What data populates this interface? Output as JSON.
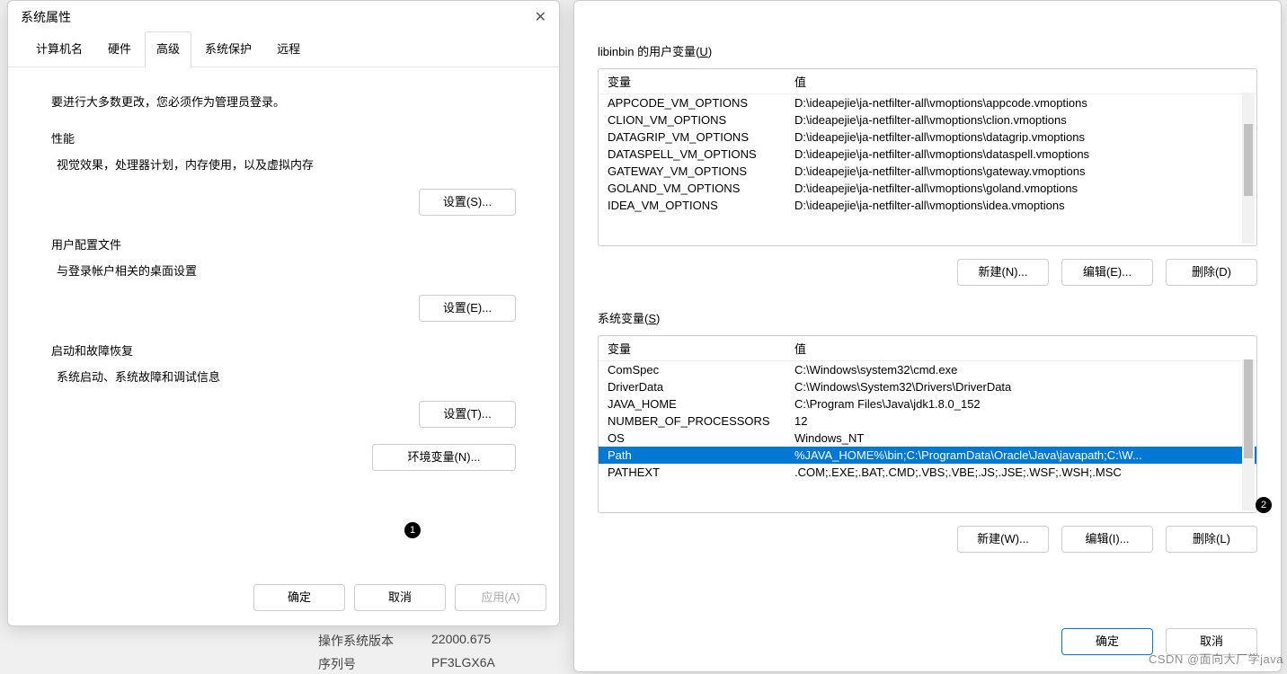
{
  "sysprops": {
    "title": "系统属性",
    "tabs": [
      "计算机名",
      "硬件",
      "高级",
      "系统保护",
      "远程"
    ],
    "active_tab": "高级",
    "admin_note": "要进行大多数更改，您必须作为管理员登录。",
    "perf": {
      "title": "性能",
      "desc": "视觉效果，处理器计划，内存使用，以及虚拟内存",
      "btn": "设置(S)..."
    },
    "profiles": {
      "title": "用户配置文件",
      "desc": "与登录帐户相关的桌面设置",
      "btn": "设置(E)..."
    },
    "startup": {
      "title": "启动和故障恢复",
      "desc": "系统启动、系统故障和调试信息",
      "btn": "设置(T)..."
    },
    "env_btn": "环境变量(N)...",
    "ok": "确定",
    "cancel": "取消",
    "apply": "应用(A)"
  },
  "env": {
    "user_title_pre": "libinbin 的用户变量(",
    "user_title_u": "U",
    "user_title_post": ")",
    "sys_title_pre": "系统变量(",
    "sys_title_u": "S",
    "sys_title_post": ")",
    "hdr_var": "变量",
    "hdr_val": "值",
    "user_vars": [
      {
        "name": "APPCODE_VM_OPTIONS",
        "value": "D:\\ideapejie\\ja-netfilter-all\\vmoptions\\appcode.vmoptions"
      },
      {
        "name": "CLION_VM_OPTIONS",
        "value": "D:\\ideapejie\\ja-netfilter-all\\vmoptions\\clion.vmoptions"
      },
      {
        "name": "DATAGRIP_VM_OPTIONS",
        "value": "D:\\ideapejie\\ja-netfilter-all\\vmoptions\\datagrip.vmoptions"
      },
      {
        "name": "DATASPELL_VM_OPTIONS",
        "value": "D:\\ideapejie\\ja-netfilter-all\\vmoptions\\dataspell.vmoptions"
      },
      {
        "name": "GATEWAY_VM_OPTIONS",
        "value": "D:\\ideapejie\\ja-netfilter-all\\vmoptions\\gateway.vmoptions"
      },
      {
        "name": "GOLAND_VM_OPTIONS",
        "value": "D:\\ideapejie\\ja-netfilter-all\\vmoptions\\goland.vmoptions"
      },
      {
        "name": "IDEA_VM_OPTIONS",
        "value": "D:\\ideapejie\\ja-netfilter-all\\vmoptions\\idea.vmoptions"
      }
    ],
    "sys_vars": [
      {
        "name": "ComSpec",
        "value": "C:\\Windows\\system32\\cmd.exe"
      },
      {
        "name": "DriverData",
        "value": "C:\\Windows\\System32\\Drivers\\DriverData"
      },
      {
        "name": "JAVA_HOME",
        "value": "C:\\Program Files\\Java\\jdk1.8.0_152"
      },
      {
        "name": "NUMBER_OF_PROCESSORS",
        "value": "12"
      },
      {
        "name": "OS",
        "value": "Windows_NT"
      },
      {
        "name": "Path",
        "value": "%JAVA_HOME%\\bin;C:\\ProgramData\\Oracle\\Java\\javapath;C:\\W...",
        "selected": true
      },
      {
        "name": "PATHEXT",
        "value": ".COM;.EXE;.BAT;.CMD;.VBS;.VBE;.JS;.JSE;.WSF;.WSH;.MSC"
      }
    ],
    "btn_new_u": "新建(N)...",
    "btn_edit_u": "编辑(E)...",
    "btn_del_u": "删除(D)",
    "btn_new_s": "新建(W)...",
    "btn_edit_s": "编辑(I)...",
    "btn_del_s": "删除(L)",
    "ok": "确定",
    "cancel": "取消"
  },
  "badges": {
    "b1": "1",
    "b2": "2"
  },
  "bg": {
    "osver_label": "操作系统版本",
    "osver_value": "22000.675",
    "serial_label": "序列号",
    "serial_value": "PF3LGX6A"
  },
  "watermark": "CSDN @面向大厂学java"
}
